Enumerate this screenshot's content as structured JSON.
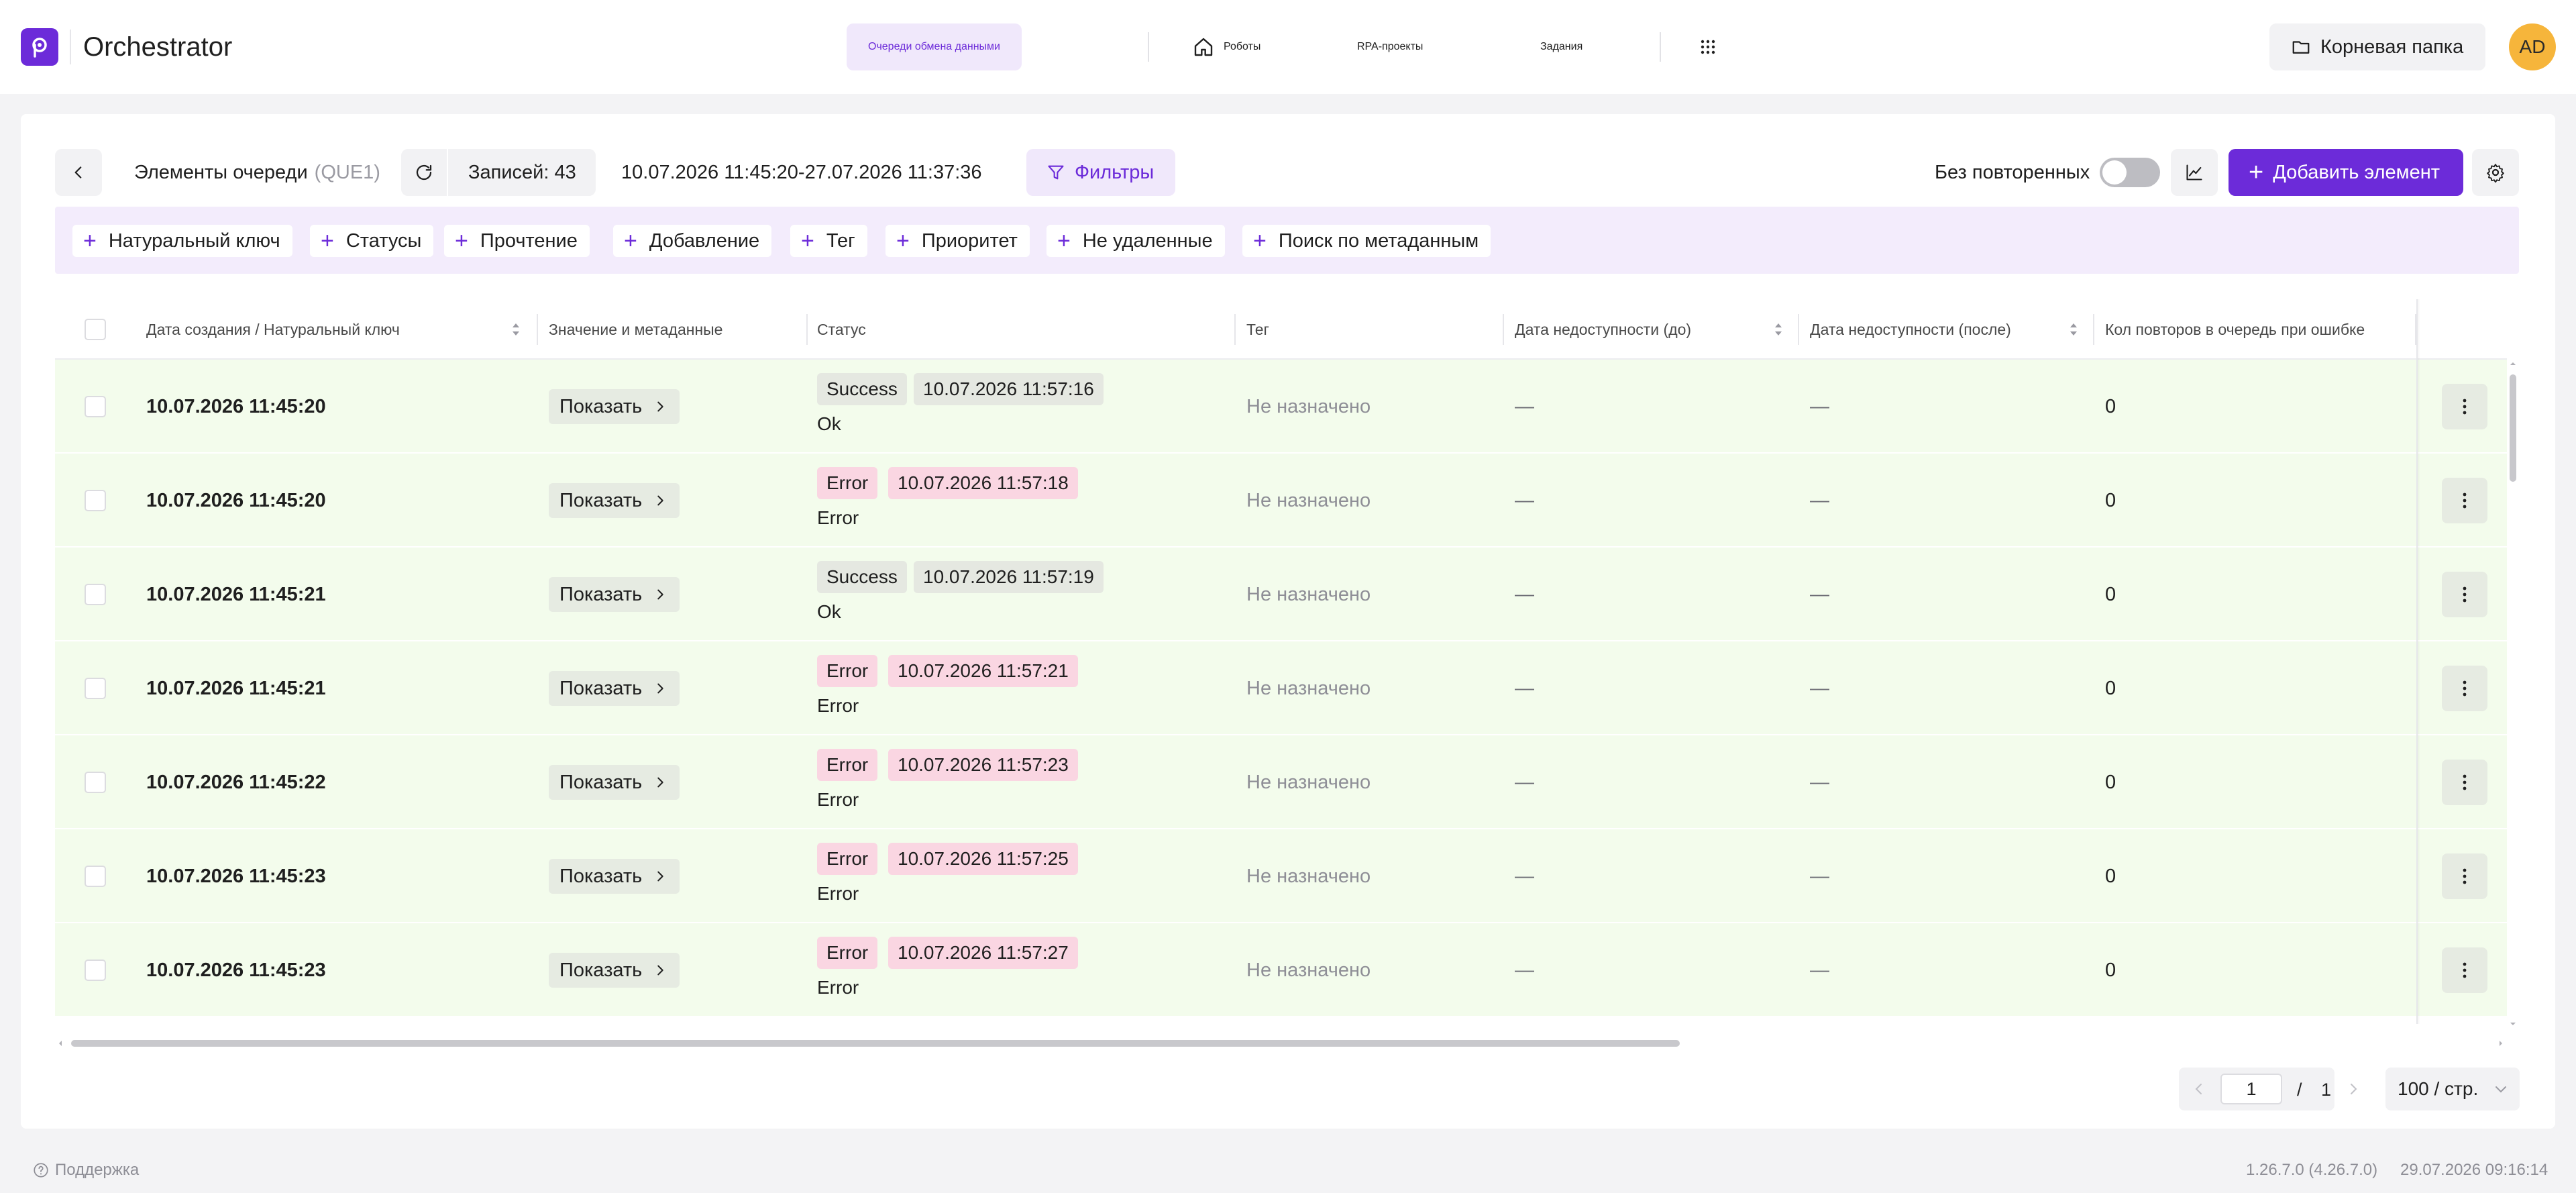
{
  "app": {
    "title": "Orchestrator"
  },
  "nav": {
    "queues": "Очереди обмена данными",
    "robots": "Роботы",
    "projects": "RPA-проекты",
    "jobs": "Задания"
  },
  "folder": {
    "label": "Корневая папка"
  },
  "user": {
    "initials": "AD"
  },
  "toolbar": {
    "title": "Элементы очереди",
    "queue_code": "(QUE1)",
    "records": "Записей: 43",
    "date_range": "10.07.2026 11:45:20-27.07.2026 11:37:36",
    "filters": "Фильтры",
    "no_duplicates": "Без повторенных",
    "add_element": "Добавить элемент",
    "toggle_on": false
  },
  "filter_chips": [
    "Натуральный ключ",
    "Статусы",
    "Прочтение",
    "Добавление",
    "Тег",
    "Приоритет",
    "Не удаленные",
    "Поиск по метаданным"
  ],
  "columns": {
    "created": "Дата создания / Натуральный ключ",
    "value": "Значение и метаданные",
    "status": "Статус",
    "tag": "Тег",
    "unavail_before": "Дата недоступности (до)",
    "unavail_after": "Дата недоступности (после)",
    "retries": "Кол повторов в очередь при ошибке"
  },
  "rows": [
    {
      "created": "10.07.2026 11:45:20",
      "show": "Показать",
      "status": "Success",
      "status_time": "10.07.2026 11:57:16",
      "status_text": "Ok",
      "tag": "Не назначено",
      "before": "—",
      "after": "—",
      "retries": "0"
    },
    {
      "created": "10.07.2026 11:45:20",
      "show": "Показать",
      "status": "Error",
      "status_time": "10.07.2026 11:57:18",
      "status_text": "Error",
      "tag": "Не назначено",
      "before": "—",
      "after": "—",
      "retries": "0"
    },
    {
      "created": "10.07.2026 11:45:21",
      "show": "Показать",
      "status": "Success",
      "status_time": "10.07.2026 11:57:19",
      "status_text": "Ok",
      "tag": "Не назначено",
      "before": "—",
      "after": "—",
      "retries": "0"
    },
    {
      "created": "10.07.2026 11:45:21",
      "show": "Показать",
      "status": "Error",
      "status_time": "10.07.2026 11:57:21",
      "status_text": "Error",
      "tag": "Не назначено",
      "before": "—",
      "after": "—",
      "retries": "0"
    },
    {
      "created": "10.07.2026 11:45:22",
      "show": "Показать",
      "status": "Error",
      "status_time": "10.07.2026 11:57:23",
      "status_text": "Error",
      "tag": "Не назначено",
      "before": "—",
      "after": "—",
      "retries": "0"
    },
    {
      "created": "10.07.2026 11:45:23",
      "show": "Показать",
      "status": "Error",
      "status_time": "10.07.2026 11:57:25",
      "status_text": "Error",
      "tag": "Не назначено",
      "before": "—",
      "after": "—",
      "retries": "0"
    },
    {
      "created": "10.07.2026 11:45:23",
      "show": "Показать",
      "status": "Error",
      "status_time": "10.07.2026 11:57:27",
      "status_text": "Error",
      "tag": "Не назначено",
      "before": "—",
      "after": "—",
      "retries": "0"
    }
  ],
  "pagination": {
    "current": "1",
    "separator": "/",
    "total": "1",
    "per_page": "100 / стр."
  },
  "footer": {
    "support": "Поддержка",
    "version": "1.26.7.0 (4.26.7.0)",
    "timestamp": "29.07.2026 09:16:14"
  },
  "colors": {
    "accent": "#6c2bd9",
    "row_bg": "#f3fcec",
    "error_badge": "#fad6e2",
    "avatar": "#f6b53b"
  }
}
